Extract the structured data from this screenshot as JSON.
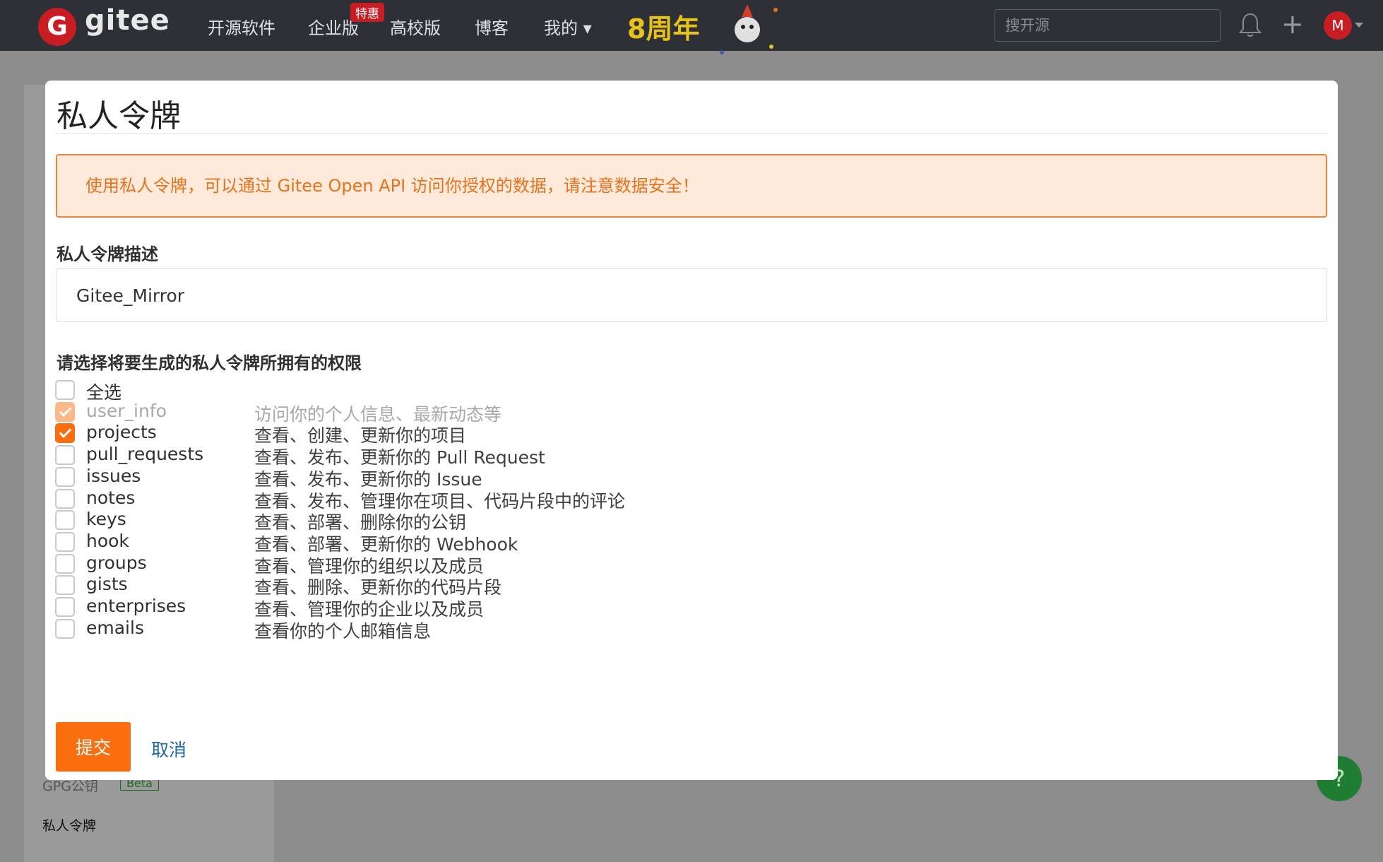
{
  "navbar": {
    "logo_letter": "G",
    "brand": "gitee",
    "items": [
      {
        "label": "开源软件"
      },
      {
        "label": "企业版",
        "badge": "特惠"
      },
      {
        "label": "高校版"
      },
      {
        "label": "博客"
      },
      {
        "label": "我的 ▾"
      }
    ],
    "anniversary": "8周年",
    "search_placeholder": "搜开源",
    "plus": "+",
    "avatar_letter": "M"
  },
  "background": {
    "sidebar_items": [
      {
        "label": "GPG公钥",
        "badge": "Beta"
      },
      {
        "label": "私人令牌"
      }
    ],
    "help_label": "?"
  },
  "modal": {
    "title": "私人令牌",
    "alert": "使用私人令牌，可以通过 Gitee Open API 访问你授权的数据，请注意数据安全！",
    "description_label": "私人令牌描述",
    "description_value": "Gitee_Mirror",
    "permissions_title": "请选择将要生成的私人令牌所拥有的权限",
    "select_all_label": "全选",
    "permissions": [
      {
        "name": "user_info",
        "desc": "访问你的个人信息、最新动态等",
        "checked": true,
        "disabled": true
      },
      {
        "name": "projects",
        "desc": "查看、创建、更新你的项目",
        "checked": true,
        "disabled": false
      },
      {
        "name": "pull_requests",
        "desc": "查看、发布、更新你的 Pull Request",
        "checked": false,
        "disabled": false
      },
      {
        "name": "issues",
        "desc": "查看、发布、更新你的 Issue",
        "checked": false,
        "disabled": false
      },
      {
        "name": "notes",
        "desc": "查看、发布、管理你在项目、代码片段中的评论",
        "checked": false,
        "disabled": false
      },
      {
        "name": "keys",
        "desc": "查看、部署、删除你的公钥",
        "checked": false,
        "disabled": false
      },
      {
        "name": "hook",
        "desc": "查看、部署、更新你的 Webhook",
        "checked": false,
        "disabled": false
      },
      {
        "name": "groups",
        "desc": "查看、管理你的组织以及成员",
        "checked": false,
        "disabled": false
      },
      {
        "name": "gists",
        "desc": "查看、删除、更新你的代码片段",
        "checked": false,
        "disabled": false
      },
      {
        "name": "enterprises",
        "desc": "查看、管理你的企业以及成员",
        "checked": false,
        "disabled": false
      },
      {
        "name": "emails",
        "desc": "查看你的个人邮箱信息",
        "checked": false,
        "disabled": false
      }
    ],
    "submit_label": "提交",
    "cancel_label": "取消"
  },
  "colors": {
    "navbar_bg": "#2d3037",
    "brand_red": "#c71d23",
    "accent_orange": "#fb6e10",
    "alert_bg": "#fdeadb",
    "alert_border": "#f0843c",
    "link_blue": "#1d6aa5"
  }
}
